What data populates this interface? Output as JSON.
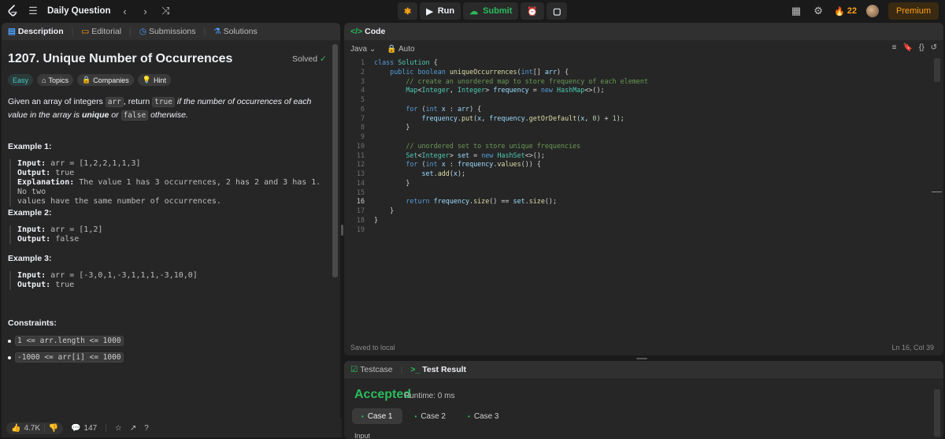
{
  "topbar": {
    "title": "Daily Question",
    "run_label": "Run",
    "submit_label": "Submit",
    "streak": "22",
    "premium_label": "Premium"
  },
  "description": {
    "tabs": [
      "Description",
      "Editorial",
      "Submissions",
      "Solutions"
    ],
    "title": "1207. Unique Number of Occurrences",
    "status": "Solved",
    "tags": [
      "Easy",
      "Topics",
      "Companies",
      "Hint"
    ],
    "statement": {
      "p1": "Given an array of integers ",
      "c1": "arr",
      "p2": ", return ",
      "c2": "true",
      "p3": " if the number of occurrences of each value in the array is ",
      "p4": "unique",
      "p5": " or ",
      "c3": "false",
      "p6": " otherwise."
    },
    "examples": [
      {
        "title": "Example 1:",
        "input_label": "Input:",
        "input": "arr = [1,2,2,1,1,3]",
        "output_label": "Output:",
        "output": "true",
        "explanation_label": "Explanation:",
        "explanation_l1": "The value 1 has 3 occurrences, 2 has 2 and 3 has 1. No two",
        "explanation_l2": "values have the same number of occurrences."
      },
      {
        "title": "Example 2:",
        "input_label": "Input:",
        "input": "arr = [1,2]",
        "output_label": "Output:",
        "output": "false"
      },
      {
        "title": "Example 3:",
        "input_label": "Input:",
        "input": "arr = [-3,0,1,-3,1,1,1,-3,10,0]",
        "output_label": "Output:",
        "output": "true"
      }
    ],
    "constraints_title": "Constraints:",
    "constraints": [
      "1 <= arr.length <= 1000",
      "-1000 <= arr[i] <= 1000"
    ],
    "footer": {
      "likes": "4.7K",
      "comments": "147"
    }
  },
  "code": {
    "tab": "Code",
    "language": "Java",
    "mode": "Auto",
    "line_numbers": [
      "1",
      "2",
      "3",
      "4",
      "5",
      "6",
      "7",
      "8",
      "9",
      "10",
      "11",
      "12",
      "13",
      "14",
      "15",
      "16",
      "17",
      "18",
      "19"
    ],
    "saved": "Saved to local",
    "cursor": "Ln 16, Col 39"
  },
  "result": {
    "tabs": [
      "Testcase",
      "Test Result"
    ],
    "status": "Accepted",
    "runtime": "Runtime: 0 ms",
    "cases": [
      "Case 1",
      "Case 2",
      "Case 3"
    ],
    "input_label": "Input"
  },
  "colors": {
    "accent_green": "#2cbb5d",
    "accent_orange": "#ffa116",
    "easy_teal": "#46c6c2"
  }
}
